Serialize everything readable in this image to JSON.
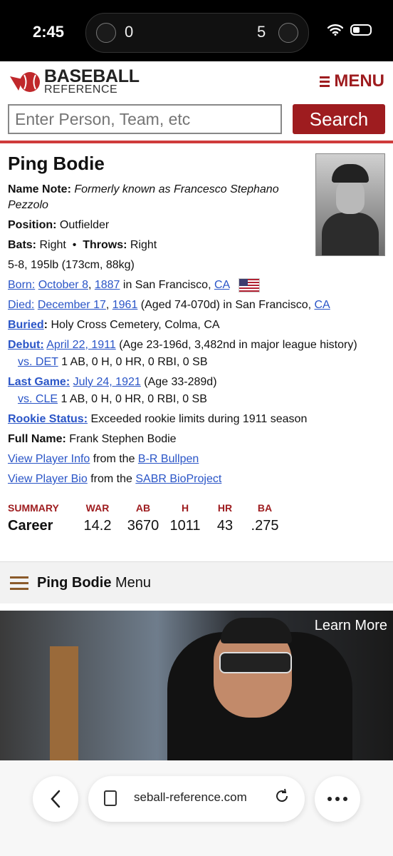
{
  "status_bar": {
    "time": "2:45",
    "score_home": "0",
    "score_away": "5"
  },
  "header": {
    "brand_line1": "BASEBALL",
    "brand_line2": "REFERENCE",
    "menu_label": "MENU",
    "search_placeholder": "Enter Person, Team, etc",
    "search_button": "Search"
  },
  "player": {
    "name": "Ping Bodie",
    "name_note_label": "Name Note:",
    "name_note": "Formerly known as Francesco Stephano Pezzolo",
    "position_label": "Position:",
    "position": "Outfielder",
    "bats_label": "Bats:",
    "bats": "Right",
    "throws_label": "Throws:",
    "throws": "Right",
    "size": "5-8, 195lb (173cm, 88kg)",
    "born_label": "Born:",
    "born_date": "October 8",
    "born_year": "1887",
    "born_place_pre": "in San Francisco,",
    "born_state": "CA",
    "died_label": "Died:",
    "died_date": "December 17",
    "died_year": "1961",
    "died_text": "(Aged 74-070d) in San Francisco,",
    "died_state": "CA",
    "buried_label": "Buried",
    "buried": "Holy Cross Cemetery, Colma, CA",
    "debut_label": "Debut:",
    "debut_date": "April 22, 1911",
    "debut_text": "(Age 23-196d, 3,482nd in major league history)",
    "debut_vs": "vs. DET",
    "debut_line": "1 AB, 0 H, 0 HR, 0 RBI, 0 SB",
    "last_label": "Last Game:",
    "last_date": "July 24, 1921",
    "last_text": "(Age 33-289d)",
    "last_vs": "vs. CLE",
    "last_line": "1 AB, 0 H, 0 HR, 0 RBI, 0 SB",
    "rookie_label": "Rookie Status:",
    "rookie": "Exceeded rookie limits during 1911 season",
    "full_name_label": "Full Name:",
    "full_name": "Frank Stephen Bodie",
    "info_link": "View Player Info",
    "info_from": "from the",
    "info_src": "B-R Bullpen",
    "bio_link": "View Player Bio",
    "bio_from": "from the",
    "bio_src": "SABR BioProject"
  },
  "summary": {
    "headers": [
      "SUMMARY",
      "WAR",
      "AB",
      "H",
      "HR",
      "BA"
    ],
    "career": [
      "Career",
      "14.2",
      "3670",
      "1011",
      "43",
      ".275"
    ]
  },
  "player_menu": {
    "name": "Ping Bodie",
    "label": "Menu"
  },
  "ad": {
    "cta": "Learn More"
  },
  "browser": {
    "url": "seball-reference.com"
  },
  "colors": {
    "brand_red": "#9e1c1f",
    "link": "#2a55c7"
  }
}
